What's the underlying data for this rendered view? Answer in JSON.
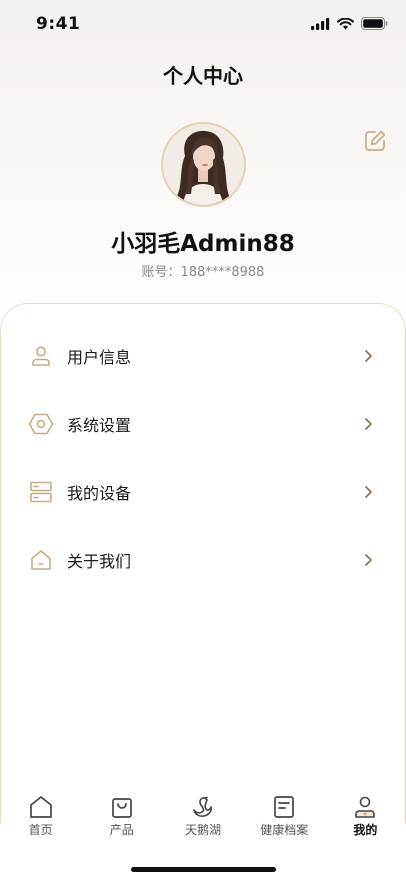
{
  "status_bar": {
    "time": "9:41"
  },
  "header": {
    "title": "个人中心"
  },
  "profile": {
    "nickname": "小羽毛Admin88",
    "account_label": "账号：",
    "account_value": "188****8988"
  },
  "menu": {
    "items": [
      {
        "label": "用户信息",
        "icon": "user-icon"
      },
      {
        "label": "系统设置",
        "icon": "settings-hexagon-icon"
      },
      {
        "label": "我的设备",
        "icon": "device-server-icon"
      },
      {
        "label": "关于我们",
        "icon": "about-house-icon"
      }
    ]
  },
  "tab_bar": {
    "tabs": [
      {
        "label": "首页",
        "icon": "home-icon"
      },
      {
        "label": "产品",
        "icon": "shopping-bag-icon"
      },
      {
        "label": "天鹅湖",
        "icon": "swan-icon"
      },
      {
        "label": "健康档案",
        "icon": "health-record-icon"
      },
      {
        "label": "我的",
        "icon": "profile-icon",
        "active": true
      }
    ]
  },
  "colors": {
    "accent_gold": "#c7ac85",
    "text_primary": "#111111",
    "text_secondary": "#8a8a8a"
  }
}
